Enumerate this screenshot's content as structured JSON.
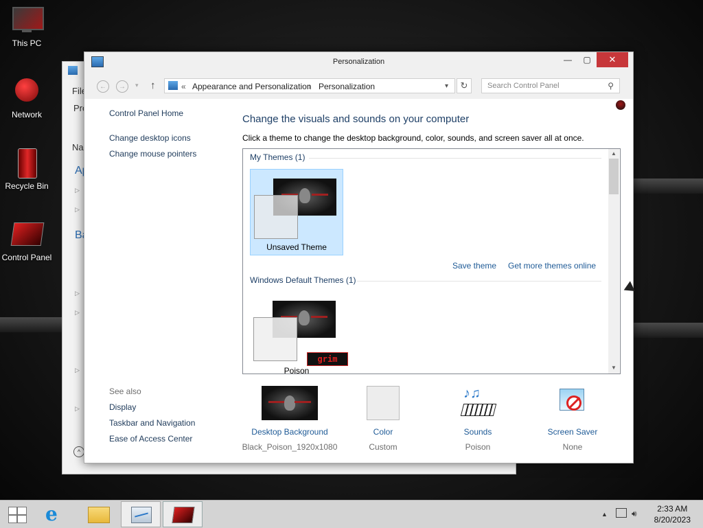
{
  "desktop": {
    "icons": [
      {
        "label": "This PC"
      },
      {
        "label": "Network"
      },
      {
        "label": "Recycle Bin"
      },
      {
        "label": "Control Panel"
      }
    ]
  },
  "background_window": {
    "menu": "File",
    "tab": "Pro",
    "column_header": "Nar",
    "section_a": "Ap",
    "section_b": "Ba"
  },
  "window": {
    "title": "Personalization",
    "controls": {
      "minimize": "—",
      "maximize": "▢",
      "close": "✕"
    },
    "breadcrumb": {
      "prefix": "«",
      "items": [
        "Appearance and Personalization",
        "Personalization"
      ],
      "separator": "›"
    },
    "search": {
      "placeholder": "Search Control Panel"
    }
  },
  "left_nav": {
    "home": "Control Panel Home",
    "links": [
      "Change desktop icons",
      "Change mouse pointers"
    ],
    "see_also_label": "See also",
    "see_also": [
      "Display",
      "Taskbar and Navigation",
      "Ease of Access Center"
    ]
  },
  "main": {
    "heading": "Change the visuals and sounds on your computer",
    "subtext": "Click a theme to change the desktop background, color, sounds, and screen saver all at once.",
    "my_themes": {
      "label": "My Themes (1)",
      "themes": [
        {
          "name": "Unsaved Theme",
          "selected": true
        }
      ],
      "save_link": "Save theme",
      "more_link": "Get more themes online"
    },
    "default_themes": {
      "label": "Windows Default Themes (1)",
      "themes": [
        {
          "name": "Poison",
          "badge": "grim"
        }
      ]
    }
  },
  "bottom": [
    {
      "label": "Desktop Background",
      "value": "Black_Poison_1920x1080",
      "icon": "wallpaper-thumbnail"
    },
    {
      "label": "Color",
      "value": "Custom",
      "icon": "color-swatch"
    },
    {
      "label": "Sounds",
      "value": "Poison",
      "icon": "sounds-icon"
    },
    {
      "label": "Screen Saver",
      "value": "None",
      "icon": "screen-saver-icon"
    }
  ],
  "taskbar": {
    "time": "2:33 AM",
    "date": "8/20/2023"
  },
  "colors": {
    "accent_link": "#1e5a96",
    "close_button": "#c7373a",
    "selection": "#cce8ff"
  }
}
